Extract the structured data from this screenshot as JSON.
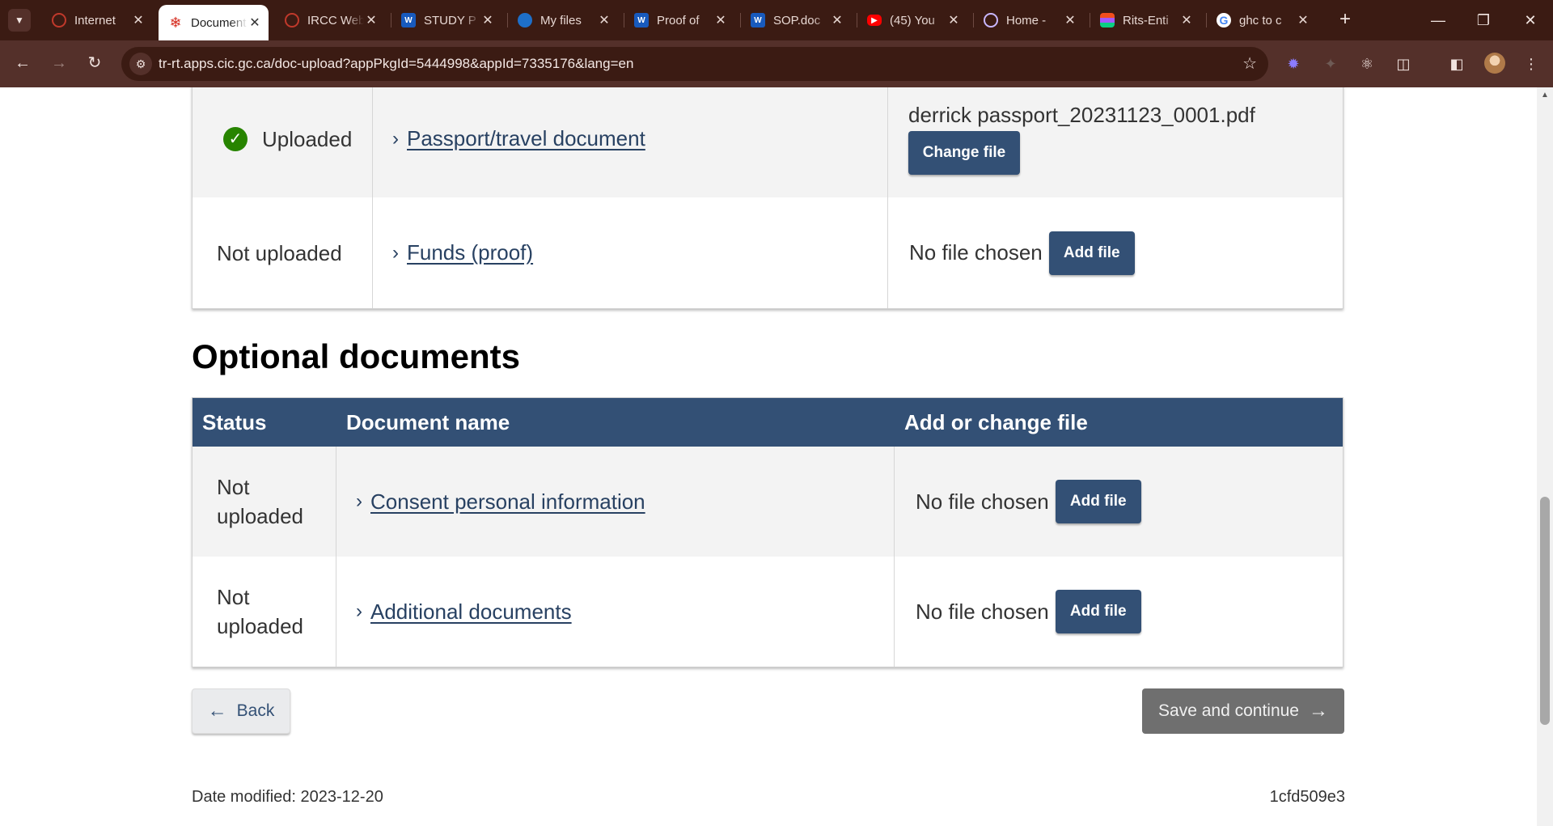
{
  "browser": {
    "tabs": [
      {
        "title": "Internet",
        "favicon": "maple-leaf-red-icon",
        "active": false
      },
      {
        "title": "Document",
        "favicon": "maple-leaf-icon",
        "active": true
      },
      {
        "title": "IRCC Web",
        "favicon": "maple-leaf-red-icon",
        "active": false
      },
      {
        "title": "STUDY P",
        "favicon": "word-icon",
        "active": false
      },
      {
        "title": "My files",
        "favicon": "onedrive-icon",
        "active": false
      },
      {
        "title": "Proof of",
        "favicon": "word-icon",
        "active": false
      },
      {
        "title": "SOP.doc",
        "favicon": "word-icon",
        "active": false
      },
      {
        "title": "(45) You",
        "favicon": "youtube-icon",
        "active": false
      },
      {
        "title": "Home - ",
        "favicon": "site-icon",
        "active": false
      },
      {
        "title": "Rits-Enti",
        "favicon": "figma-icon",
        "active": false
      },
      {
        "title": "ghc to c",
        "favicon": "google-icon",
        "active": false
      }
    ],
    "url": "tr-rt.apps.cic.gc.ca/doc-upload?appPkgId=5444998&appId=7335176&lang=en"
  },
  "required_docs": {
    "rows": [
      {
        "status": "Uploaded",
        "document": "Passport/travel document",
        "file": "derrick passport_20231123_0001.pdf",
        "button": "Change file",
        "uploaded": true
      },
      {
        "status": "Not uploaded",
        "document": "Funds (proof)",
        "file": "No file chosen",
        "button": "Add file",
        "uploaded": false
      }
    ]
  },
  "optional_docs": {
    "title": "Optional documents",
    "headers": {
      "status": "Status",
      "document": "Document name",
      "file": "Add or change file"
    },
    "rows": [
      {
        "status": "Not uploaded",
        "document": "Consent personal information",
        "file": "No file chosen",
        "button": "Add file"
      },
      {
        "status": "Not uploaded",
        "document": "Additional documents",
        "file": "No file chosen",
        "button": "Add file"
      }
    ]
  },
  "actions": {
    "back": "Back",
    "save": "Save and continue"
  },
  "footer": {
    "date_modified": "Date modified: 2023-12-20",
    "version": "1cfd509e3"
  },
  "colors": {
    "header_blue": "#335075",
    "link": "#284162",
    "success": "#278400",
    "disabled_button": "#6f6f6f"
  }
}
